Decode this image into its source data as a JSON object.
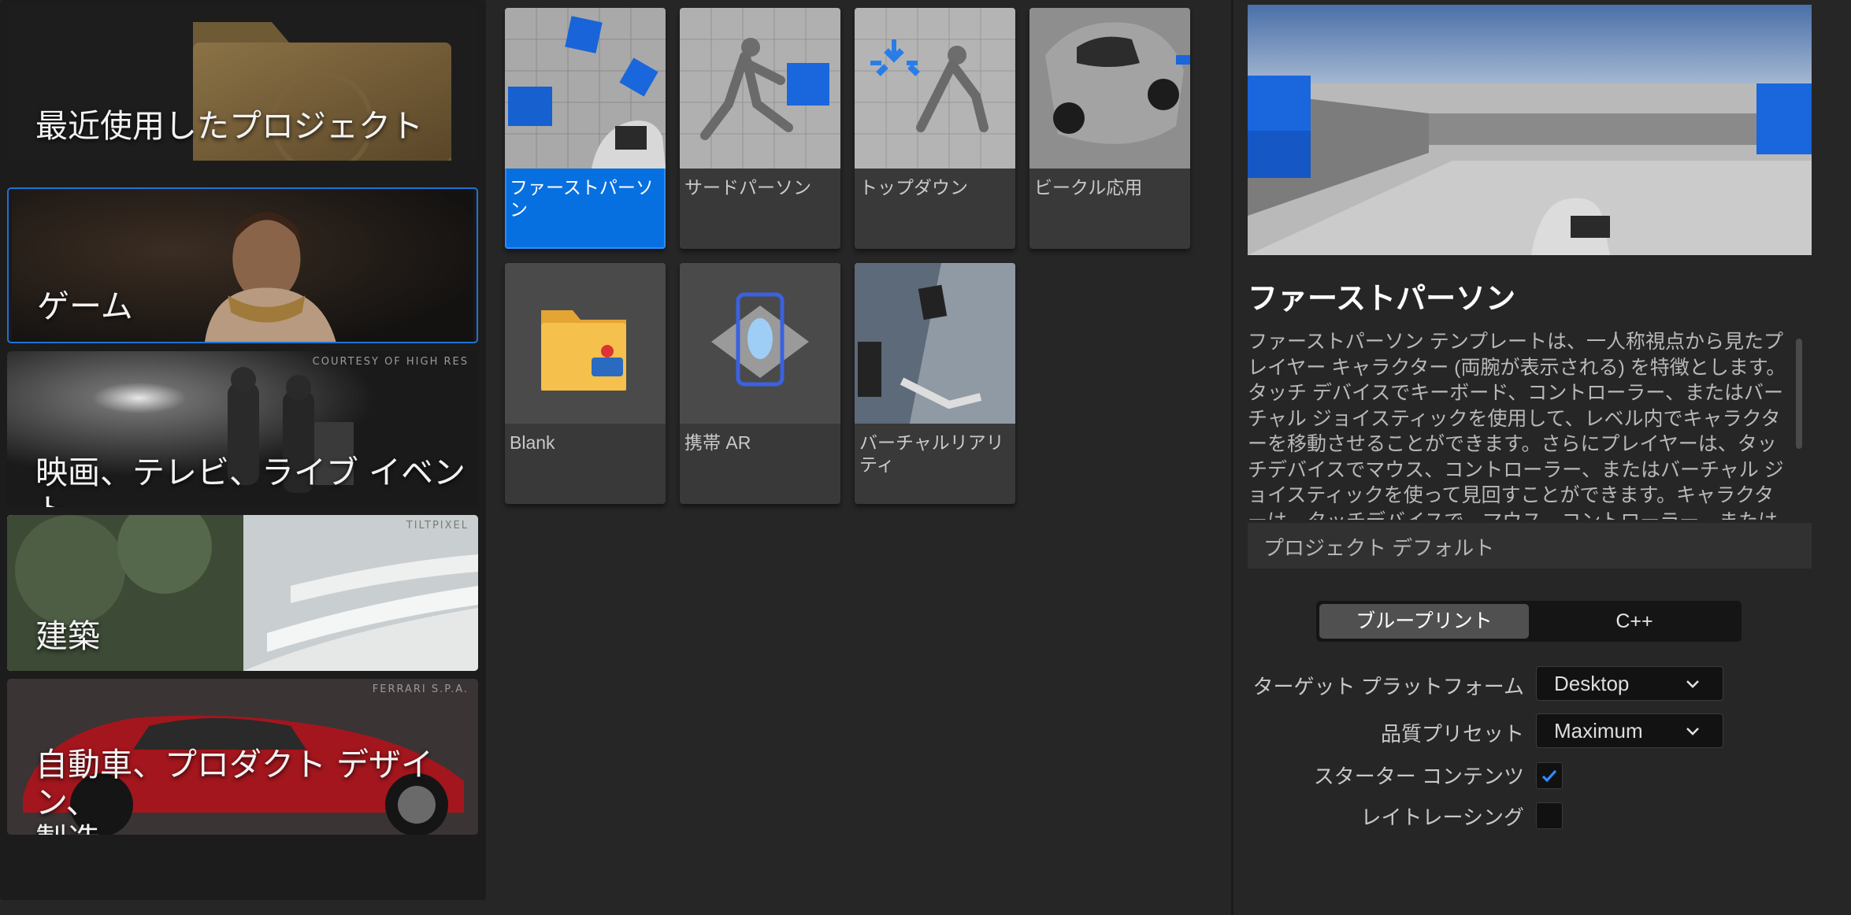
{
  "categories": [
    {
      "label": "最近使用したプロジェクト",
      "credit": ""
    },
    {
      "label": "ゲーム",
      "credit": ""
    },
    {
      "label": "映画、テレビ、ライブ イベント",
      "credit": "COURTESY OF HIGH RES"
    },
    {
      "label": "建築",
      "credit": "TILTPIXEL"
    },
    {
      "label": "自動車、プロダクト デザイン、\n製造",
      "credit": "FERRARI S.P.A."
    }
  ],
  "templates": [
    {
      "label": "ファーストパーソン",
      "selected": true
    },
    {
      "label": "サードパーソン"
    },
    {
      "label": "トップダウン"
    },
    {
      "label": "ビークル応用"
    },
    {
      "label": "Blank"
    },
    {
      "label": "携帯 AR"
    },
    {
      "label": "バーチャルリアリティ"
    }
  ],
  "detail": {
    "title": "ファーストパーソン",
    "description": "ファーストパーソン テンプレートは、一人称視点から見たプレイヤー キャラクター (両腕が表示される) を特徴とします。タッチ デバイスでキーボード、コントローラー、またはバーチャル ジョイスティックを使用して、レベル内でキャラクターを移動させることができます。さらにプレイヤーは、タッチデバイスでマウス、コントローラー、またはバーチャル ジョイスティックを使って見回すことができます。キャラクターは、タッチデバイスで、マウス、コントローラー、またはバーチャル ジョイスティック"
  },
  "project_defaults": {
    "heading": "プロジェクト デフォルト",
    "language_options": [
      "ブループリント",
      "C++"
    ],
    "selected_language": "ブループリント",
    "target_platform_label": "ターゲット プラットフォーム",
    "target_platform_value": "Desktop",
    "quality_preset_label": "品質プリセット",
    "quality_preset_value": "Maximum",
    "starter_content_label": "スターター コンテンツ",
    "starter_content_checked": true,
    "raytracing_label": "レイトレーシング",
    "raytracing_checked": false
  },
  "colors": {
    "accent": "#0770e0",
    "panel": "#1c1c1c",
    "background": "#262626"
  }
}
